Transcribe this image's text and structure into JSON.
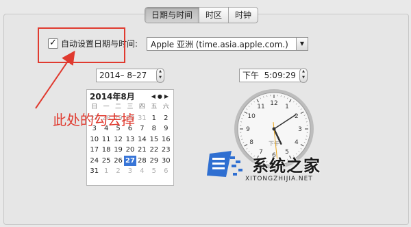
{
  "tabs": [
    {
      "label": "日期与时间",
      "active": true
    },
    {
      "label": "时区",
      "active": false
    },
    {
      "label": "时钟",
      "active": false
    }
  ],
  "auto_set": {
    "label": "自动设置日期与时间:",
    "checked": true,
    "check_glyph": "✓"
  },
  "time_server": {
    "value": "Apple 亚洲 (time.asia.apple.com.)",
    "arrow": "▼"
  },
  "date_field": {
    "value": "2014– 8–27"
  },
  "time_field": {
    "value": "下午  5:09:29"
  },
  "stepper": {
    "up": "▲",
    "down": "▼"
  },
  "calendar": {
    "title": "2014年8月",
    "nav": "◀●▶",
    "weekdays": [
      "日",
      "一",
      "二",
      "三",
      "四",
      "五",
      "六"
    ],
    "weeks": [
      [
        "27",
        "28",
        "29",
        "30",
        "31",
        "1",
        "2"
      ],
      [
        "3",
        "4",
        "5",
        "6",
        "7",
        "8",
        "9"
      ],
      [
        "10",
        "11",
        "12",
        "13",
        "14",
        "15",
        "16"
      ],
      [
        "17",
        "18",
        "19",
        "20",
        "21",
        "22",
        "23"
      ],
      [
        "24",
        "25",
        "26",
        "27",
        "28",
        "29",
        "30"
      ],
      [
        "31",
        "1",
        "2",
        "3",
        "4",
        "5",
        "6"
      ]
    ],
    "selected": "27"
  },
  "clock": {
    "numerals": [
      "12",
      "1",
      "2",
      "3",
      "4",
      "5",
      "6",
      "7",
      "8",
      "9",
      "10",
      "11"
    ],
    "ampm": "下午",
    "hour": 5,
    "minute": 9,
    "second": 29
  },
  "annotation": {
    "text": "此处的勾去掉",
    "color": "#e03a2f"
  },
  "watermark": {
    "name": "系统之家",
    "url": "XITONGZHIJIA.NET"
  }
}
